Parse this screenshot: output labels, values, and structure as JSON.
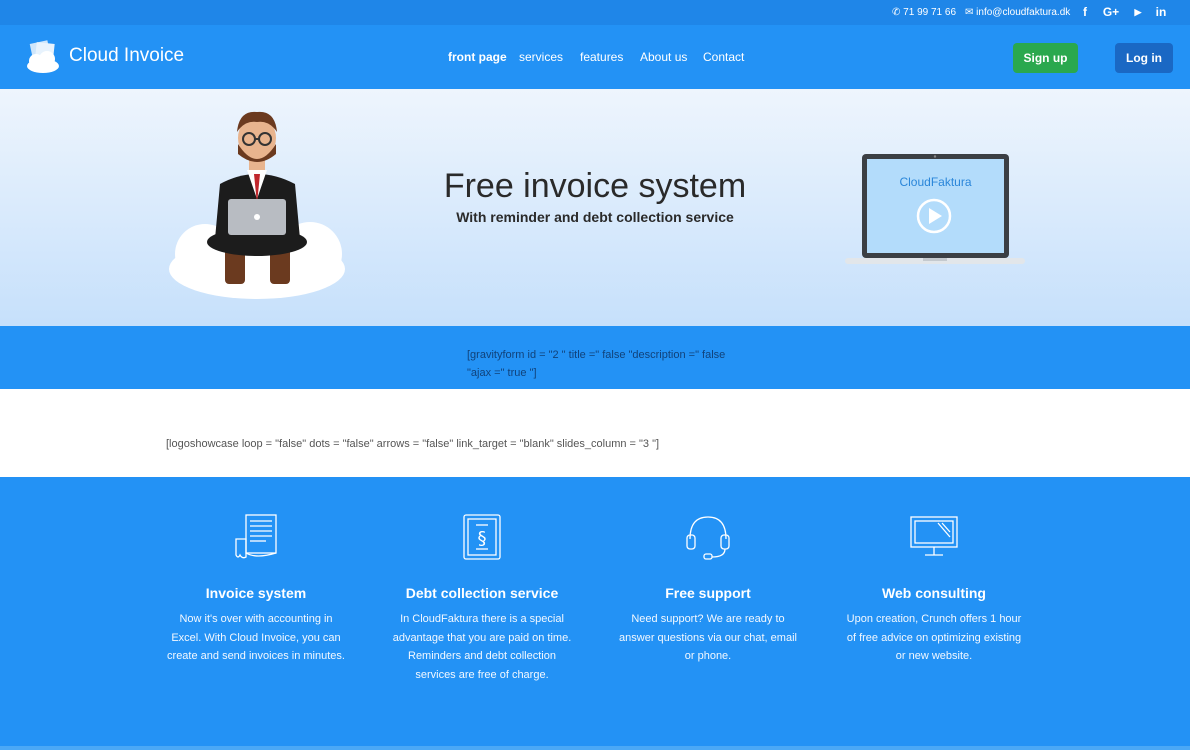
{
  "topbar": {
    "phone": "71 99 71 66",
    "email": "info@cloudfaktura.dk",
    "social": [
      "f",
      "G+",
      "▶",
      "in"
    ]
  },
  "header": {
    "logo": "Cloud Invoice",
    "nav": [
      "front page",
      "services",
      "features",
      "About us",
      "Contact"
    ],
    "signup": "Sign up",
    "login": "Log in"
  },
  "hero": {
    "title": "Free invoice system",
    "subtitle": "With reminder and debt collection service",
    "video_label": "CloudFaktura"
  },
  "shortcodes": {
    "form": "[gravityform id = \"2 \" title =\" false \"description =\" false \"ajax =\" true \"]",
    "logos": "[logoshowcase loop = \"false\" dots = \"false\" arrows = \"false\" link_target = \"blank\" slides_column = \"3 \"]"
  },
  "features": [
    {
      "icon": "invoice-icon",
      "title": "Invoice system",
      "text": "Now it's over with accounting in Excel. With Cloud Invoice, you can create and send invoices in minutes."
    },
    {
      "icon": "law-book-icon",
      "title": "Debt collection service",
      "text": "In CloudFaktura there is a special advantage that you are paid on time. Reminders and debt collection services are free of charge."
    },
    {
      "icon": "headset-icon",
      "title": "Free support",
      "text": "Need support? We are ready to answer questions via our chat, email or phone."
    },
    {
      "icon": "monitor-icon",
      "title": "Web consulting",
      "text": "Upon creation, Crunch offers 1 hour of free advice on optimizing existing or new website."
    }
  ],
  "colors": {
    "primary": "#2392f5",
    "topbar": "#1f86e8",
    "signup": "#2aa84e",
    "login": "#1a68c4"
  }
}
